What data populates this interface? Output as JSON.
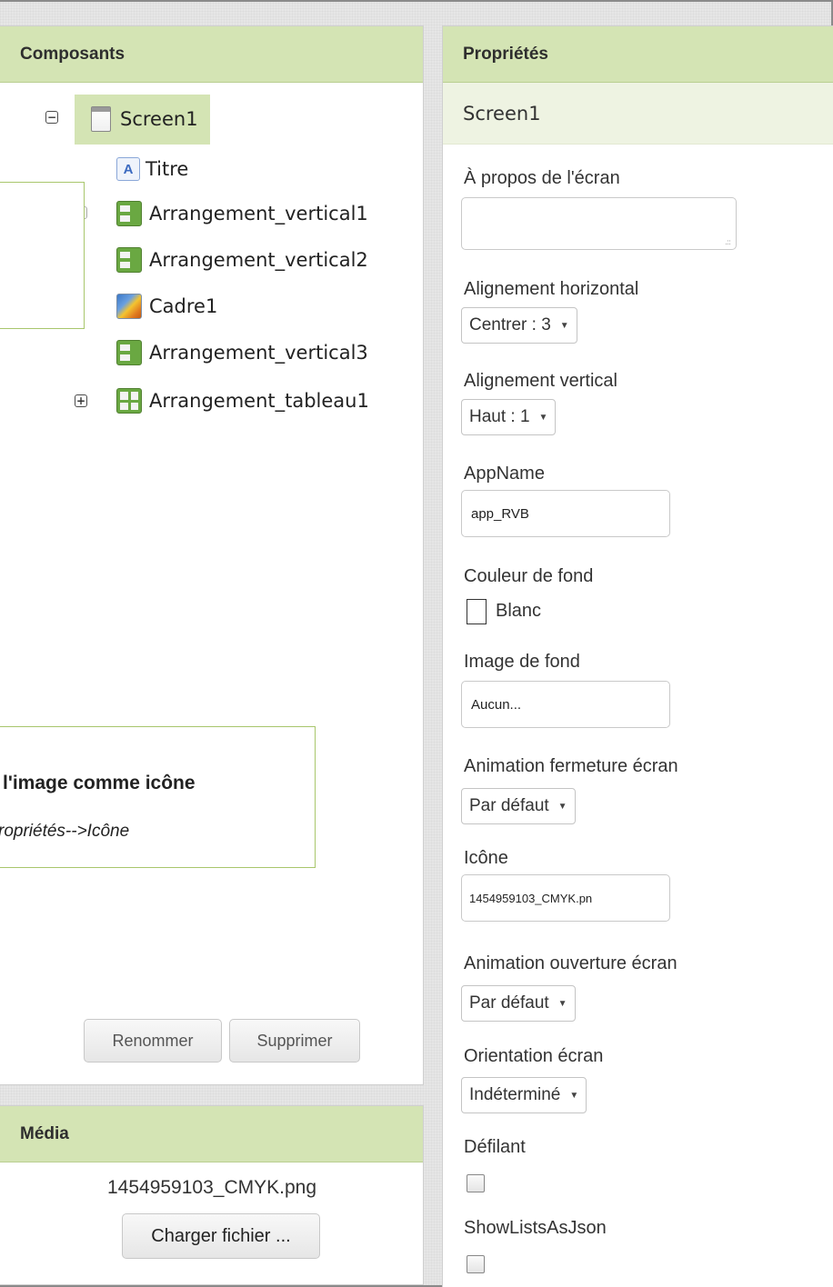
{
  "components_panel": {
    "title": "Composants",
    "tree": {
      "root": "Screen1",
      "items": [
        {
          "label": "Titre",
          "icon": "label-icon"
        },
        {
          "label": "Arrangement_vertical1",
          "icon": "vertical-arrangement-icon"
        },
        {
          "label": "Arrangement_vertical2",
          "icon": "vertical-arrangement-icon"
        },
        {
          "label": "Cadre1",
          "icon": "canvas-icon"
        },
        {
          "label": "Arrangement_vertical3",
          "icon": "vertical-arrangement-icon"
        },
        {
          "label": "Arrangement_tableau1",
          "icon": "table-arrangement-icon"
        }
      ],
      "collapse_symbol": "−",
      "expand_symbol": "+"
    },
    "rename_label": "Renommer",
    "delete_label": "Supprimer"
  },
  "media_panel": {
    "title": "Média",
    "file": "1454959103_CMYK.png",
    "upload_label": "Charger fichier ..."
  },
  "properties_panel": {
    "title": "Propriétés",
    "component": "Screen1",
    "about": {
      "label": "À propos de l'écran",
      "value": ""
    },
    "align_h": {
      "label": "Alignement horizontal",
      "value": "Centrer : 3"
    },
    "align_v": {
      "label": "Alignement vertical",
      "value": "Haut : 1"
    },
    "app_name": {
      "label": "AppName",
      "value": "app_RVB"
    },
    "bg_color": {
      "label": "Couleur de fond",
      "value": "Blanc"
    },
    "bg_image": {
      "label": "Image de fond",
      "value": "Aucun..."
    },
    "close_anim": {
      "label": "Animation fermeture écran",
      "value": "Par défaut"
    },
    "icon": {
      "label": "Icône",
      "value": "1454959103_CMYK.pn"
    },
    "open_anim": {
      "label": "Animation ouverture écran",
      "value": "Par défaut"
    },
    "orientation": {
      "label": "Orientation écran",
      "value": "Indéterminé"
    },
    "scrollable": {
      "label": "Défilant",
      "checked": false
    },
    "show_lists_json": {
      "label": "ShowListsAsJson",
      "checked": false
    }
  },
  "callout": {
    "title": "l'image comme icône",
    "subtitle": "ropriétés-->Icône"
  },
  "colors": {
    "header_green": "#d4e4b4",
    "callout_border": "#a8c66c"
  }
}
